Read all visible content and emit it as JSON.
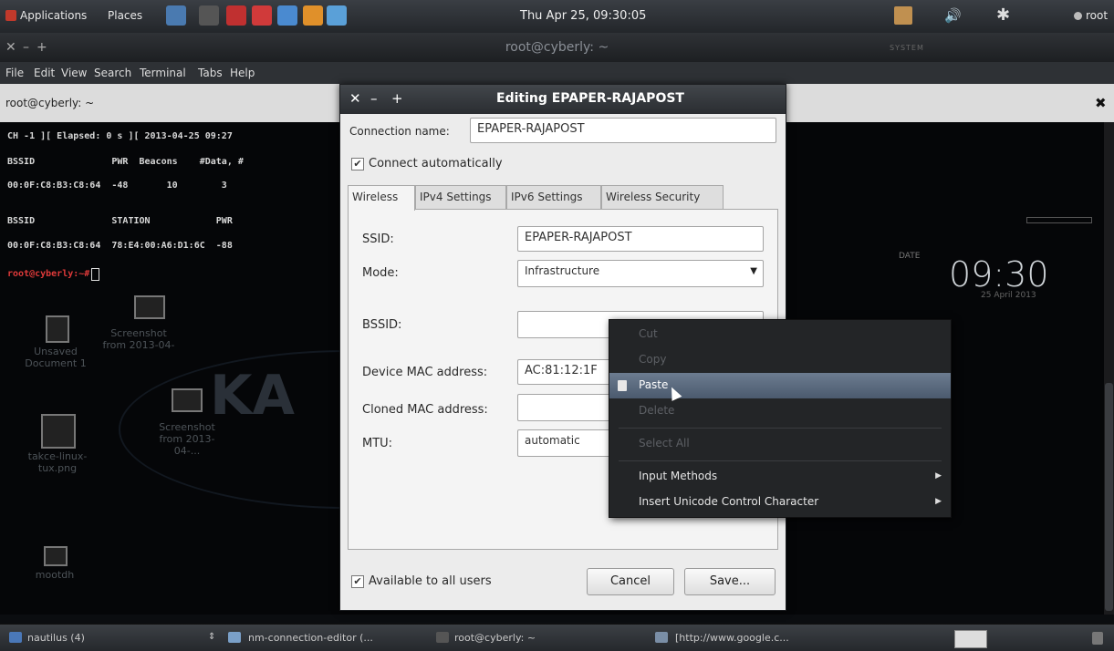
{
  "top_panel": {
    "applications": "Applications",
    "places": "Places",
    "clock": "Thu Apr 25, 09:30:05",
    "user": "root"
  },
  "terminal_window": {
    "title": "root@cyberly: ~",
    "menu": [
      "File",
      "Edit",
      "View",
      "Search",
      "Terminal",
      "Tabs",
      "Help"
    ],
    "tab_label": "root@cyberly: ~",
    "system_label": "SYSTEM",
    "lines": [
      {
        "text": "CH -1 ][ Elapsed: 0 s ][ 2013-04-25 09:27",
        "color": "#d8d8d8"
      },
      {
        "text": "BSSID              PWR  Beacons    #Data, #",
        "color": "#d8d8d8"
      },
      {
        "text": "00:0F:C8:B3:C8:64  -48       10        3",
        "color": "#d8d8d8"
      },
      {
        "text": "BSSID              STATION            PWR",
        "color": "#d8d8d8"
      },
      {
        "text": "00:0F:C8:B3:C8:64  78:E4:00:A6:D1:6C  -88",
        "color": "#d8d8d8"
      },
      {
        "text": "root@cyberly:~# ",
        "color": "#e03a3a"
      }
    ]
  },
  "desktop": {
    "icons": [
      "Unsaved Document 1",
      "Screenshot from 2013-04-",
      "Screenshot from 2013-04-...",
      "takce-linux-tux.png",
      "mootdh"
    ],
    "conky_date_label": "DATE",
    "conky_time": "09:30",
    "conky_date": "25 April 2013"
  },
  "dialog": {
    "title": "Editing EPAPER-RAJAPOST",
    "connection_name_label": "Connection name:",
    "connection_name_value": "EPAPER-RAJAPOST",
    "connect_automatically": "Connect automatically",
    "tabs": [
      "Wireless",
      "IPv4 Settings",
      "IPv6 Settings",
      "Wireless Security"
    ],
    "fields": {
      "ssid_label": "SSID:",
      "ssid_value": "EPAPER-RAJAPOST",
      "mode_label": "Mode:",
      "mode_value": "Infrastructure",
      "bssid_label": "BSSID:",
      "bssid_value": "",
      "device_mac_label": "Device MAC address:",
      "device_mac_value": "AC:81:12:1F",
      "cloned_mac_label": "Cloned MAC address:",
      "cloned_mac_value": "",
      "mtu_label": "MTU:",
      "mtu_value": "automatic"
    },
    "available_to_all_users": "Available to all users",
    "cancel": "Cancel",
    "save": "Save..."
  },
  "context_menu": {
    "items": [
      {
        "label": "Cut",
        "state": "disabled"
      },
      {
        "label": "Copy",
        "state": "disabled"
      },
      {
        "label": "Paste",
        "state": "selected"
      },
      {
        "label": "Delete",
        "state": "disabled"
      },
      {
        "label": "Select All",
        "state": "disabled"
      },
      {
        "label": "Input Methods",
        "state": "enabled"
      },
      {
        "label": "Insert Unicode Control Character",
        "state": "enabled"
      }
    ]
  },
  "taskbar": {
    "items": [
      "nautilus (4)",
      "nm-connection-editor (...",
      "root@cyberly: ~",
      "[http://www.google.c..."
    ]
  },
  "colors": {
    "menu_selected": "#5d6c80",
    "terminal_prompt": "#e03a3a",
    "dialog_bg": "#ececec"
  }
}
